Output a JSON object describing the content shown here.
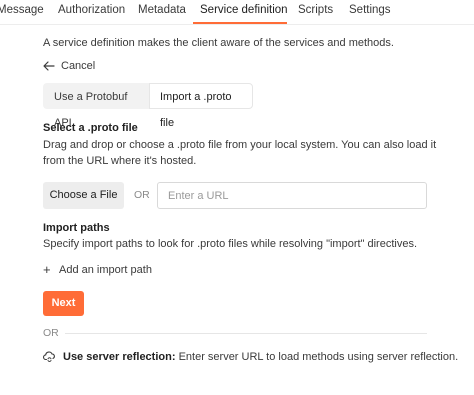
{
  "tabs": {
    "items": [
      "Message",
      "Authorization",
      "Metadata",
      "Service definition",
      "Scripts",
      "Settings"
    ],
    "active": "Service definition"
  },
  "intro": "A service definition makes the client aware of the services and methods.",
  "cancel_label": "Cancel",
  "source_toggle": {
    "option1": "Use a Protobuf API",
    "option2": "Import a .proto file",
    "selected": "Import a .proto file"
  },
  "select_proto": {
    "title": "Select a .proto file",
    "description_line1": "Drag and drop or choose a .proto file from your local system. You can also load it",
    "description_line2": "from the URL where it's hosted.",
    "choose_label": "Choose a File",
    "or_label": "OR",
    "url_placeholder": "Enter a URL"
  },
  "import_paths": {
    "title": "Import paths",
    "description": "Specify import paths to look for .proto files while resolving \"import\" directives.",
    "add_label": "Add an import path"
  },
  "next_label": "Next",
  "divider_or": "OR",
  "reflection": {
    "bold": "Use server reflection:",
    "text": "Enter server URL to load methods using server reflection."
  },
  "colors": {
    "accent": "#ff6c37",
    "text": "#212121",
    "muted": "#8a8a8a"
  },
  "icons": {
    "cancel": "arrow-left-icon",
    "add": "plus-icon",
    "reflection": "cloud-sync-icon"
  }
}
